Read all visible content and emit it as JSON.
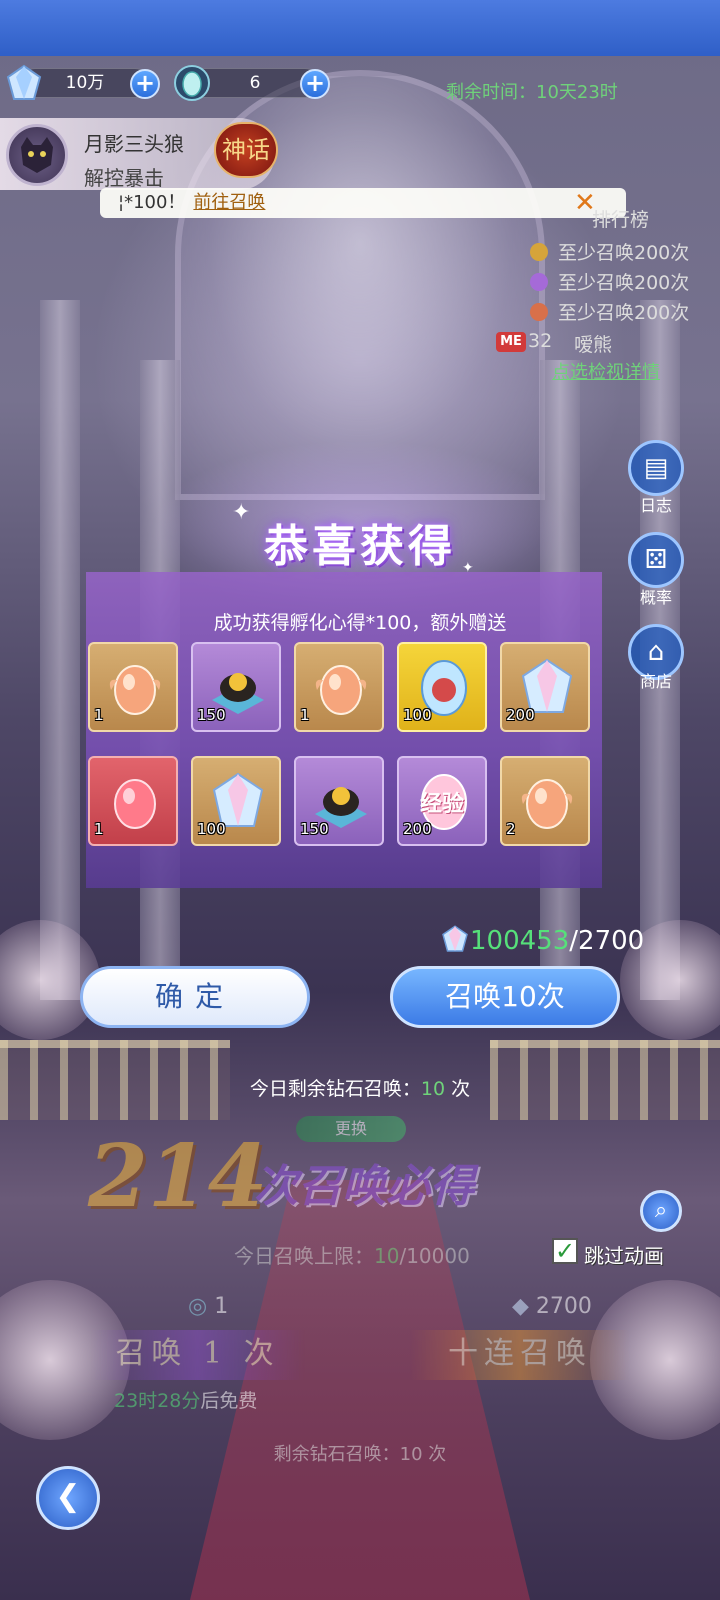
{
  "colors": {
    "accent_blue": "#3c7be6",
    "green_text": "#6fd27a",
    "gold": "#f0b53a",
    "purple_modal": "#8b62bb"
  },
  "currency": {
    "diamonds": {
      "icon": "diamond-icon",
      "value": "10万"
    },
    "eggs": {
      "icon": "egg-icon",
      "value": "6"
    },
    "plus": "+"
  },
  "time_left": "剩余时间：10天23时",
  "pet": {
    "name": "月影三头狼",
    "skill": "解控暴击",
    "badge": "神话"
  },
  "notice": {
    "text": "¦*100！",
    "link": "前往召唤",
    "close": "✕"
  },
  "rank": {
    "title": "排行榜",
    "rows": [
      "至少召唤200次",
      "至少召唤200次",
      "至少召唤200次"
    ],
    "me_badge": "ME",
    "me_rank": "32",
    "me_name": "嗳熊",
    "detail": "点选检视详情"
  },
  "side": {
    "log": "日志",
    "rate": "概率",
    "shop": "商店"
  },
  "modal": {
    "title": "恭喜获得",
    "subtitle": "成功获得孵化心得*100，额外赠送",
    "items": [
      {
        "icon": "orange-egg-icon",
        "qty": "1"
      },
      {
        "icon": "dark-gem-icon",
        "qty": "150"
      },
      {
        "icon": "orange-egg-icon",
        "qty": "1"
      },
      {
        "icon": "blue-pet-egg-icon",
        "qty": "100"
      },
      {
        "icon": "diamond-icon",
        "qty": "200"
      },
      {
        "icon": "red-egg-icon",
        "qty": "1"
      },
      {
        "icon": "diamond-icon",
        "qty": "100"
      },
      {
        "icon": "dark-gem-icon",
        "qty": "150"
      },
      {
        "icon": "exp-egg-icon",
        "qty": "200",
        "label": "经验"
      },
      {
        "icon": "orange-egg-icon",
        "qty": "2"
      }
    ]
  },
  "cost": {
    "have": "100453",
    "need": "/2700"
  },
  "buttons": {
    "confirm": "确定",
    "summon10": "召唤10次"
  },
  "today_left": {
    "prefix": "今日剩余钻石召唤：",
    "num": "10",
    "suffix": " 次"
  },
  "lower": {
    "swap": "更换",
    "count": "214",
    "guarantee": "次召唤必得",
    "limit_prefix": "今日召唤上限：",
    "limit_num": "10",
    "limit_total": "/10000",
    "skip": "跳过动画",
    "cost1": "1",
    "cost10": "2700",
    "summon1": "召唤 1 次",
    "summon10": "十连召唤",
    "free_time": "23时28分",
    "free_suffix": "后免费",
    "bottom_left_prefix": "剩余钻石召唤：",
    "bottom_left_num": "10",
    "bottom_left_suffix": " 次"
  }
}
